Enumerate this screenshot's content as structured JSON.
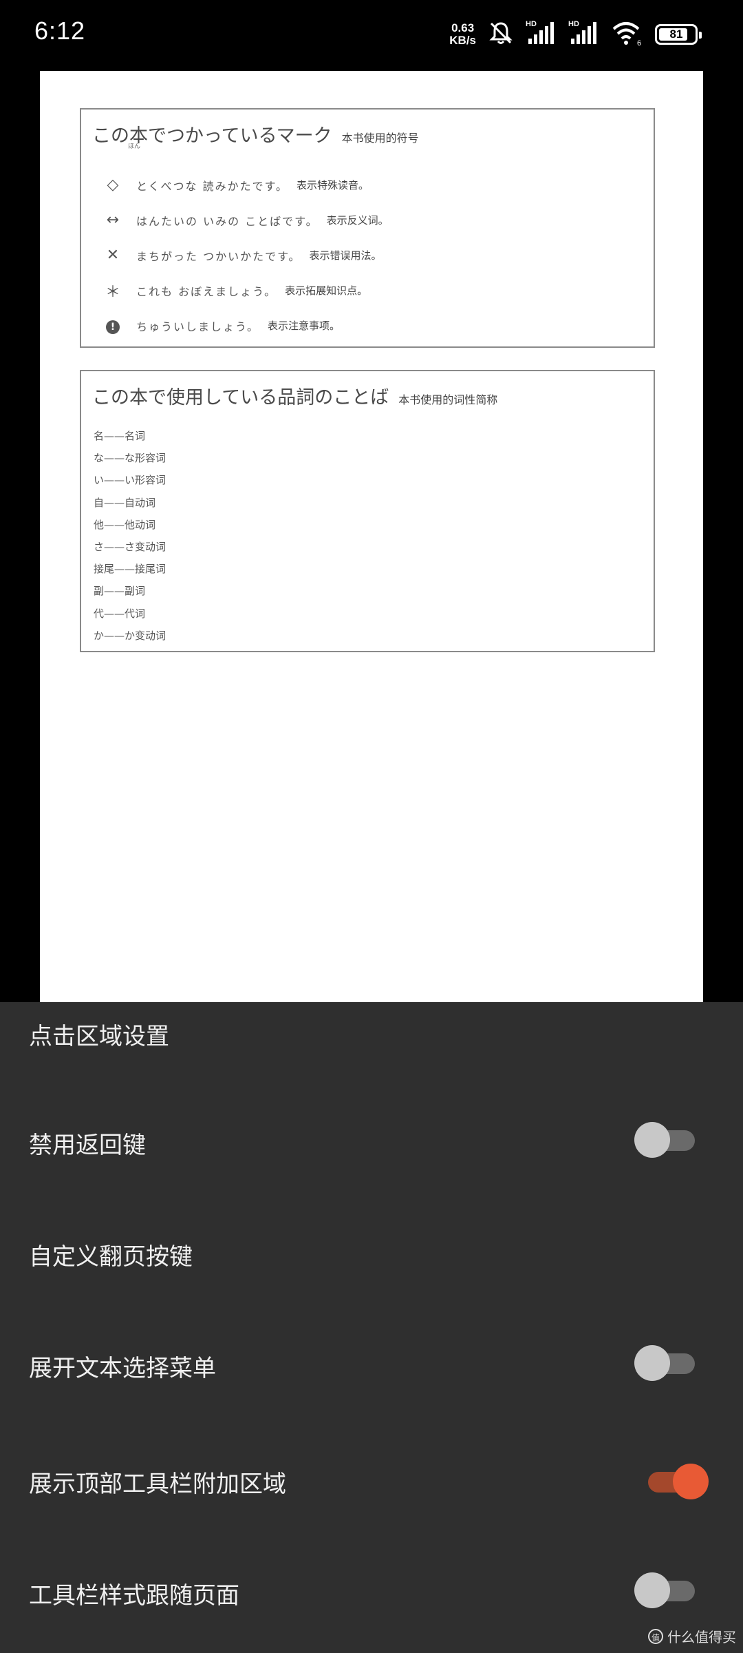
{
  "status_bar": {
    "time": "6:12",
    "net_speed_value": "0.63",
    "net_speed_unit": "KB/s",
    "battery_level": "81",
    "hd1": "HD",
    "hd2": "HD",
    "wifi_label": "6",
    "icons": [
      "mute-bell-icon",
      "signal-icon",
      "signal-icon",
      "wifi-icon",
      "battery-icon"
    ]
  },
  "book_page": {
    "marks_box": {
      "title_jp": "この本でつかっているマーク",
      "title_furigana": "ほん",
      "title_cn": "本书使用的符号",
      "items": [
        {
          "icon": "◇",
          "jp": "とくべつな 読みかたです。",
          "cn": "表示特殊读音。"
        },
        {
          "icon": "↔",
          "jp": "はんたいの いみの ことばです。",
          "cn": "表示反义词。"
        },
        {
          "icon": "✕",
          "jp": "まちがった つかいかたです。",
          "cn": "表示错误用法。"
        },
        {
          "icon": "＊",
          "jp": "これも おぼえましょう。",
          "cn": "表示拓展知识点。"
        },
        {
          "icon": "!",
          "jp": "ちゅういしましょう。",
          "cn": "表示注意事项。"
        }
      ]
    },
    "pos_box": {
      "title_jp": "この本で使用している品詞のことば",
      "title_cn": "本书使用的词性简称",
      "items": [
        "名——名词",
        "な——な形容词",
        "い——い形容词",
        "自——自动词",
        "他——他动词",
        "さ——さ变动词",
        "接尾——接尾词",
        "副——副词",
        "代——代词",
        "か——か变动词"
      ]
    }
  },
  "settings": {
    "tap_zone": "点击区域设置",
    "disable_back": {
      "label": "禁用返回键",
      "on": false
    },
    "custom_page_keys": "自定义翻页按键",
    "expand_text_menu": {
      "label": "展开文本选择菜单",
      "on": false
    },
    "show_top_toolbar_area": {
      "label": "展示顶部工具栏附加区域",
      "on": true
    },
    "toolbar_follow_page": {
      "label": "工具栏样式跟随页面",
      "on": false
    }
  },
  "watermark": {
    "badge": "值",
    "text": "什么值得买"
  },
  "colors": {
    "sheet_bg": "#2f2f2f",
    "toggle_on": "#e85a35",
    "toggle_off_knob": "#c8c8c8"
  }
}
